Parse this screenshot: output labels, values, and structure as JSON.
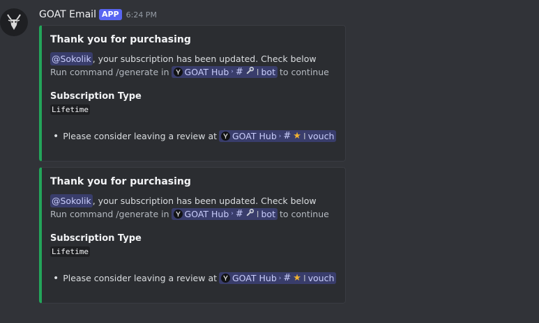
{
  "message": {
    "username": "GOAT Email",
    "badge": "APP",
    "timestamp": "6:24 PM"
  },
  "embeds": [
    {
      "title": "Thank you for purchasing",
      "mention": "@Sokolik",
      "desc_line1_rest": ", your subscription has been updated. Check below",
      "desc_line2_prefix": "Run command /generate in",
      "server_name": "GOAT Hub",
      "bot_channel": "bot",
      "desc_line2_suffix": "to continue",
      "field_name": "Subscription Type",
      "field_value": "Lifetime",
      "bullet_text": "Please consider leaving a review at",
      "vouch_channel": "vouch"
    },
    {
      "title": "Thank you for purchasing",
      "mention": "@Sokolik",
      "desc_line1_rest": ", your subscription has been updated. Check below",
      "desc_line2_prefix": "Run command /generate in",
      "server_name": "GOAT Hub",
      "bot_channel": "bot",
      "desc_line2_suffix": "to continue",
      "field_name": "Subscription Type",
      "field_value": "Lifetime",
      "bullet_text": "Please consider leaving a review at",
      "vouch_channel": "vouch"
    }
  ],
  "colors": {
    "embed_accent": "#23a55a",
    "app_badge": "#5865f2",
    "background": "#313338",
    "embed_bg": "#2b2d31"
  },
  "icons": {
    "avatar": "goat-head-icon",
    "bot_channel": "wrench-icon",
    "vouch_channel": "star-icon"
  }
}
